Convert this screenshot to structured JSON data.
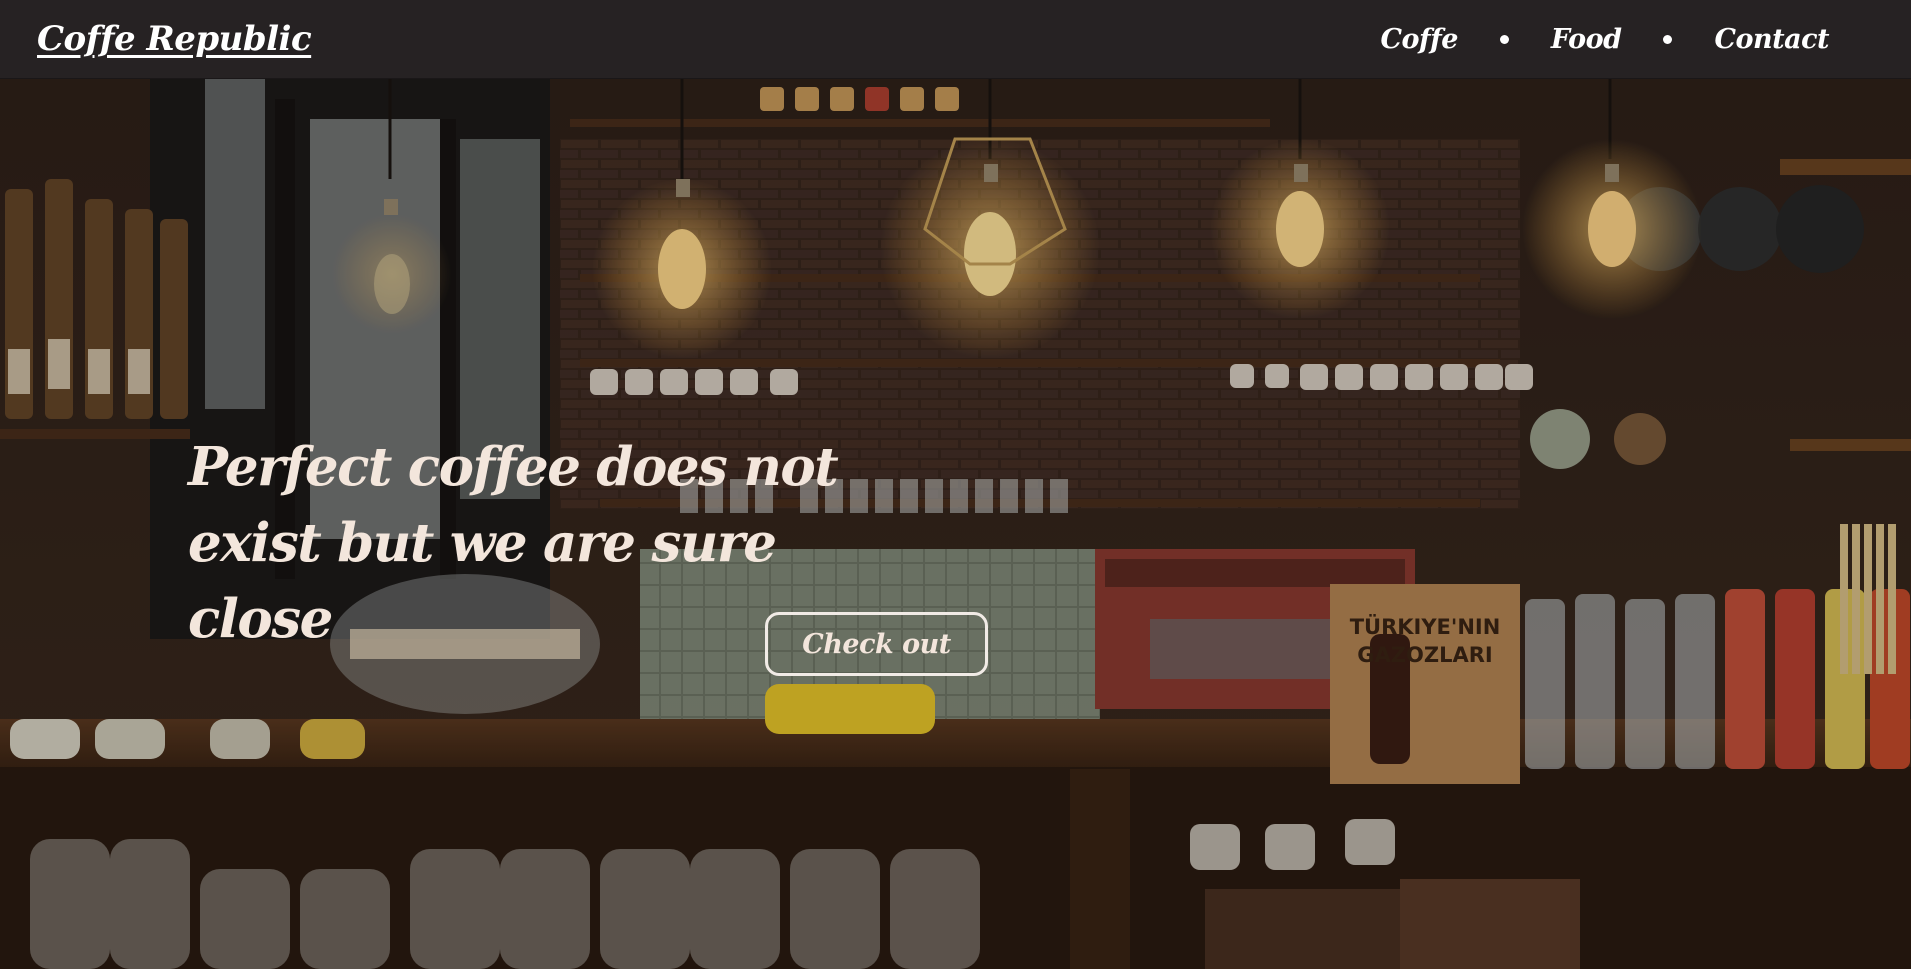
{
  "header": {
    "brand": "Coffe Republic",
    "nav": [
      {
        "label": "Coffe"
      },
      {
        "label": "Food"
      },
      {
        "label": "Contact"
      }
    ]
  },
  "hero": {
    "headline_line1": "Perfect coffee does not",
    "headline_line2": "exist but we are sure close",
    "cta_label": "Check out",
    "background_image": "coffee-shop-bar-interior",
    "box_text_line1": "TÜRKIYE'NIN",
    "box_text_line2": "GAZOZLARI"
  },
  "colors": {
    "navbar_bg": "#262223",
    "text": "#f3e6dc",
    "button_border": "#f1ebe6"
  }
}
